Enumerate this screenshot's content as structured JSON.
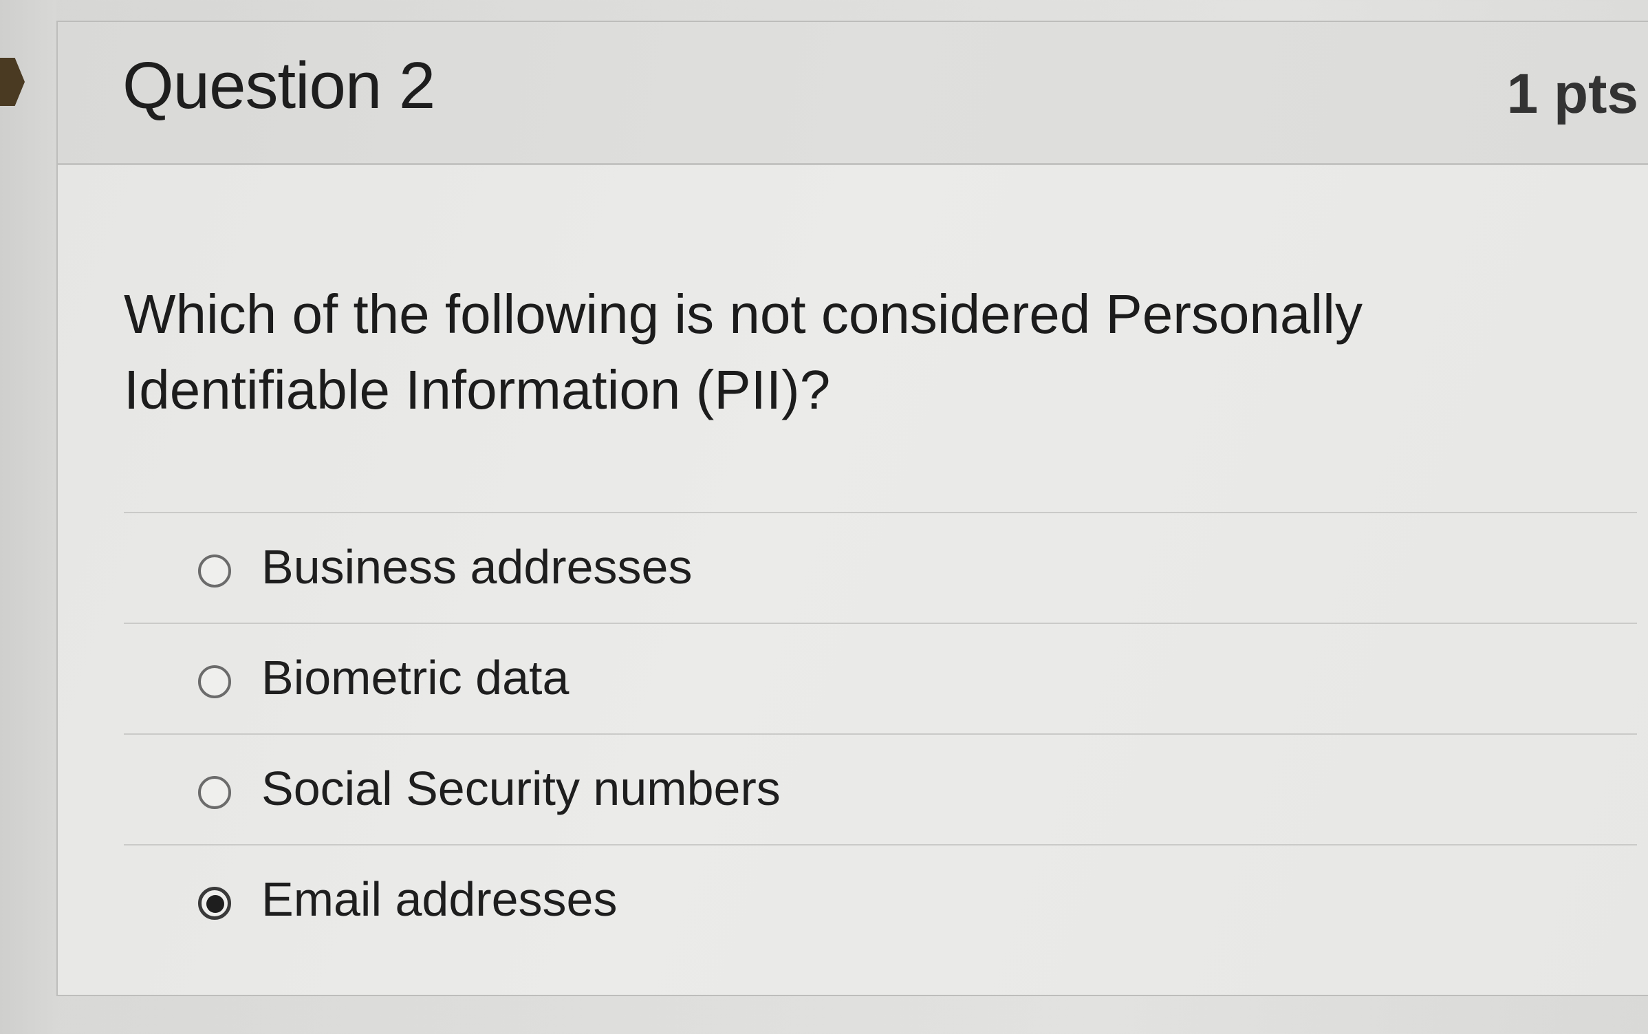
{
  "question": {
    "title": "Question 2",
    "points": "1 pts",
    "text": "Which of the following is not considered Personally Identifiable Information (PII)?",
    "answers": [
      {
        "label": "Business addresses",
        "selected": false
      },
      {
        "label": "Biometric data",
        "selected": false
      },
      {
        "label": "Social Security numbers",
        "selected": false
      },
      {
        "label": "Email addresses",
        "selected": true
      }
    ]
  },
  "icons": {
    "flag": "flag-icon"
  }
}
